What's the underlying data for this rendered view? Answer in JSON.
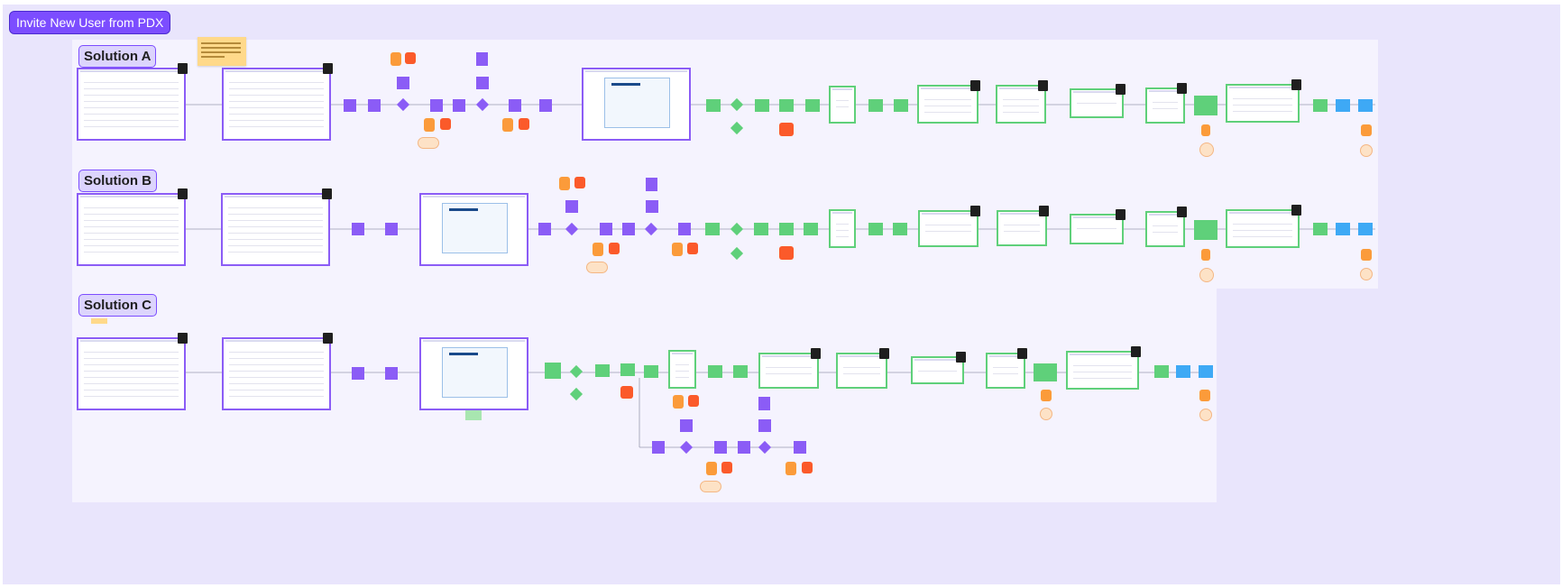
{
  "board": {
    "title": "Invite New User from PDX",
    "sections": [
      {
        "label": "Solution A"
      },
      {
        "label": "Solution B"
      },
      {
        "label": "Solution C"
      }
    ]
  },
  "colors": {
    "board_background": "#e9e5fc",
    "section_panel": "#f5f3fe",
    "title_chip": "#7c4dff",
    "screen_frame_purple": "#8b5cf6",
    "screen_frame_green": "#5fd07a",
    "step_purple": "#8b5cf6",
    "step_green": "#5fd07a",
    "step_blue": "#3ea9f5",
    "data_orange": "#fb9b3a",
    "data_red": "#fb5a2a",
    "note_peach": "#fde2c6",
    "sticky_yellow": "#ffd98a"
  },
  "icons": {
    "comment_marker": "comment-badge-icon",
    "decision": "diamond-decision-icon",
    "database": "cylinder-database-icon"
  }
}
